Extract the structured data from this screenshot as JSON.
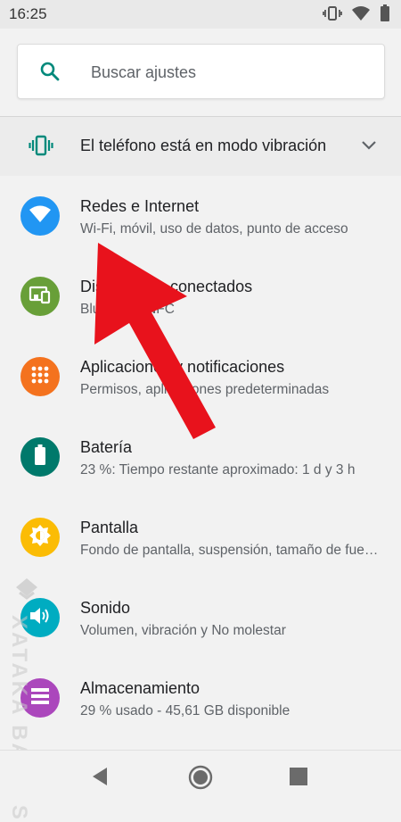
{
  "status_bar": {
    "time": "16:25",
    "icons": [
      "vibrate-icon",
      "wifi-icon",
      "battery-icon"
    ]
  },
  "search": {
    "placeholder": "Buscar ajustes",
    "icon": "search-icon",
    "accent": "#00897b"
  },
  "suggestion": {
    "text": "El teléfono está en modo vibración",
    "icon": "vibrate-icon",
    "accent": "#00897b"
  },
  "settings": [
    {
      "title": "Redes e Internet",
      "subtitle": "Wi-Fi, móvil, uso de datos, punto de acceso",
      "icon": "wifi-icon",
      "color": "#2196f3"
    },
    {
      "title": "Dispositivos conectados",
      "subtitle": "Bluetooth, NFC",
      "icon": "devices-icon",
      "color": "#689f38"
    },
    {
      "title": "Aplicaciones y notificaciones",
      "subtitle": "Permisos, aplicaciones predeterminadas",
      "icon": "apps-grid-icon",
      "color": "#f4721e"
    },
    {
      "title": "Batería",
      "subtitle": "23 %: Tiempo restante aproximado: 1 d y 3 h",
      "icon": "battery-icon",
      "color": "#00796b"
    },
    {
      "title": "Pantalla",
      "subtitle": "Fondo de pantalla, suspensión, tamaño de fuente",
      "icon": "brightness-icon",
      "color": "#fbbc05"
    },
    {
      "title": "Sonido",
      "subtitle": "Volumen, vibración y No molestar",
      "icon": "volume-icon",
      "color": "#00acc1"
    },
    {
      "title": "Almacenamiento",
      "subtitle": "29 % usado - 45,61 GB disponible",
      "icon": "storage-icon",
      "color": "#ab47bc"
    }
  ],
  "nav": {
    "icons": [
      "back-icon",
      "home-icon",
      "recents-icon"
    ]
  },
  "watermark": {
    "text": "XATAKA BASICS"
  },
  "annotation": {
    "color": "#e8121c"
  }
}
